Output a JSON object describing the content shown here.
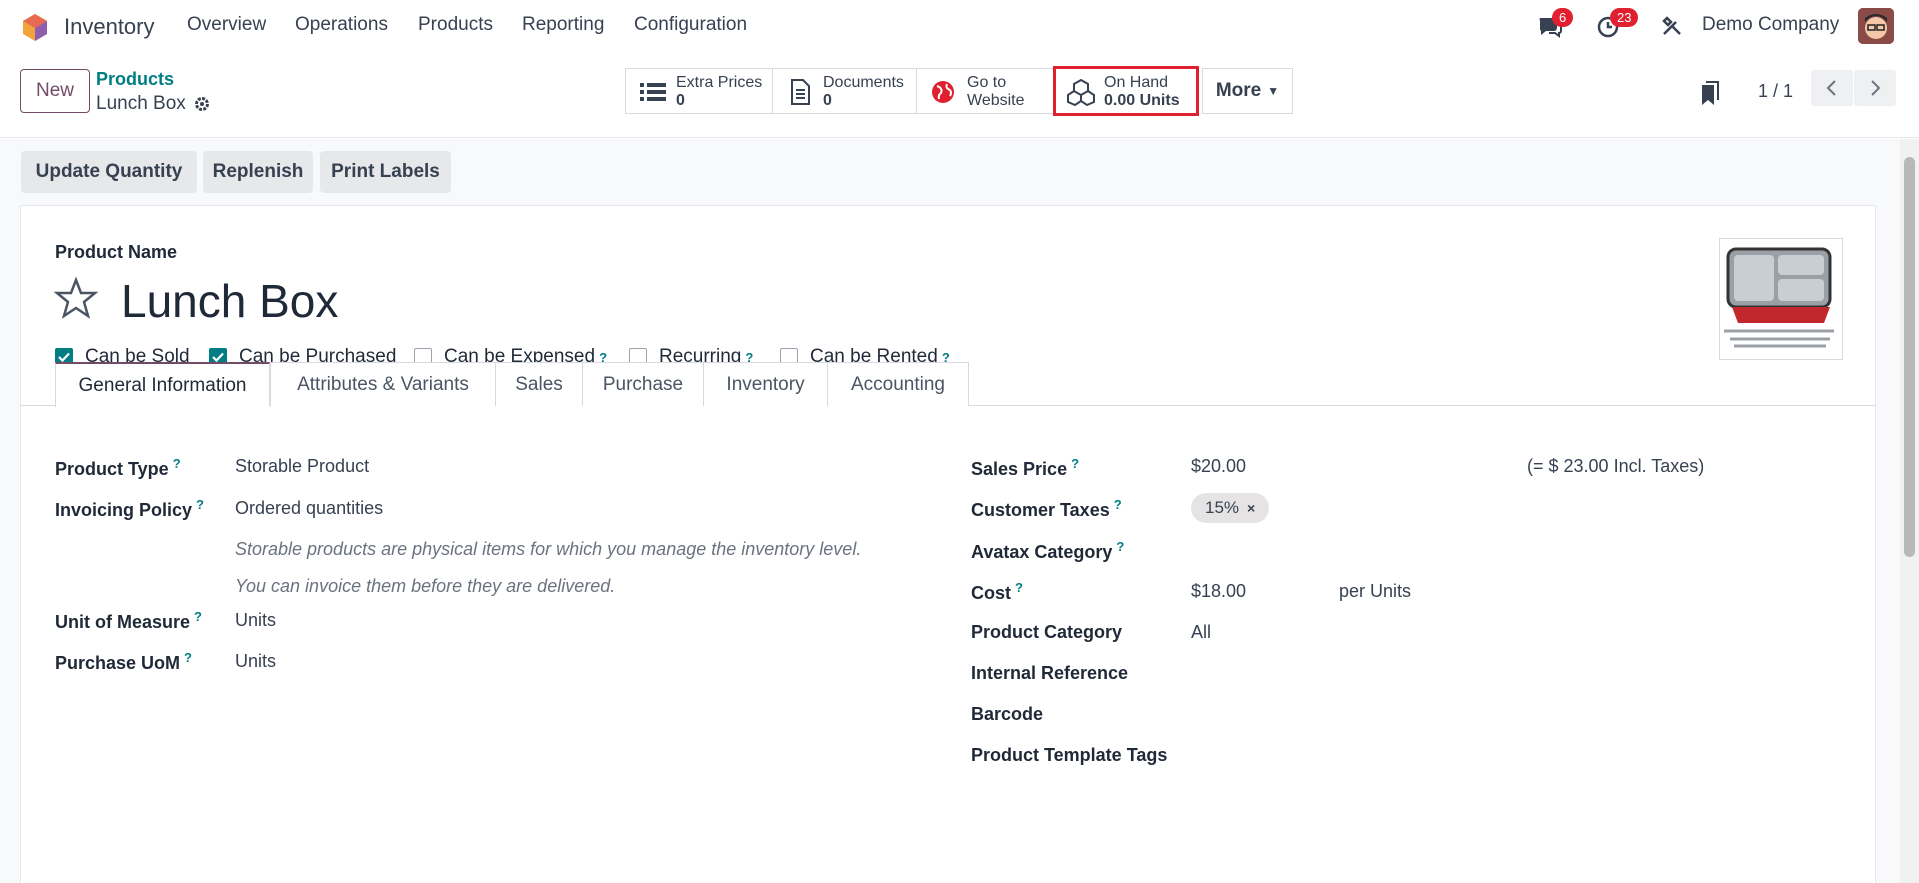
{
  "nav": {
    "app_name": "Inventory",
    "menu": [
      "Overview",
      "Operations",
      "Products",
      "Reporting",
      "Configuration"
    ],
    "messages_count": "6",
    "activities_count": "23",
    "company": "Demo Company"
  },
  "control": {
    "new_label": "New",
    "breadcrumb_parent": "Products",
    "breadcrumb_current": "Lunch Box",
    "smart_buttons": [
      {
        "line1": "Extra Prices",
        "line2": "0",
        "icon": "list-icon"
      },
      {
        "line1": "Documents",
        "line2": "0",
        "icon": "document-icon"
      },
      {
        "line1": "Go to",
        "line2": "Website",
        "icon": "globe-icon"
      },
      {
        "line1": "On Hand",
        "line2": "0.00 Units",
        "icon": "cubes-icon",
        "highlighted": true
      }
    ],
    "more_label": "More",
    "pager": "1 / 1"
  },
  "actions": [
    "Update Quantity",
    "Replenish",
    "Print Labels"
  ],
  "product": {
    "name_label": "Product Name",
    "name": "Lunch Box",
    "checkboxes": [
      {
        "label": "Can be Sold",
        "checked": true,
        "help": false
      },
      {
        "label": "Can be Purchased",
        "checked": true,
        "help": false
      },
      {
        "label": "Can be Expensed",
        "checked": false,
        "help": true
      },
      {
        "label": "Recurring",
        "checked": false,
        "help": true
      },
      {
        "label": "Can be Rented",
        "checked": false,
        "help": true
      }
    ]
  },
  "tabs": [
    "General Information",
    "Attributes & Variants",
    "Sales",
    "Purchase",
    "Inventory",
    "Accounting"
  ],
  "left_fields": {
    "product_type_label": "Product Type",
    "product_type": "Storable Product",
    "invoicing_policy_label": "Invoicing Policy",
    "invoicing_policy": "Ordered quantities",
    "note1": "Storable products are physical items for which you manage the inventory level.",
    "note2": "You can invoice them before they are delivered.",
    "uom_label": "Unit of Measure",
    "uom": "Units",
    "purchase_uom_label": "Purchase UoM",
    "purchase_uom": "Units"
  },
  "right_fields": {
    "sales_price_label": "Sales Price",
    "sales_price": "$20.00",
    "incl_taxes": "(= $ 23.00 Incl. Taxes)",
    "customer_taxes_label": "Customer Taxes",
    "tax_tag": "15%",
    "avatax_label": "Avatax Category",
    "cost_label": "Cost",
    "cost": "$18.00",
    "cost_unit": "per Units",
    "category_label": "Product Category",
    "category": "All",
    "internal_ref_label": "Internal Reference",
    "barcode_label": "Barcode",
    "tags_label": "Product Template Tags"
  },
  "colors": {
    "accent": "#714b67",
    "teal": "#017e84",
    "badge": "#e0202e",
    "highlight": "#e0202e"
  }
}
